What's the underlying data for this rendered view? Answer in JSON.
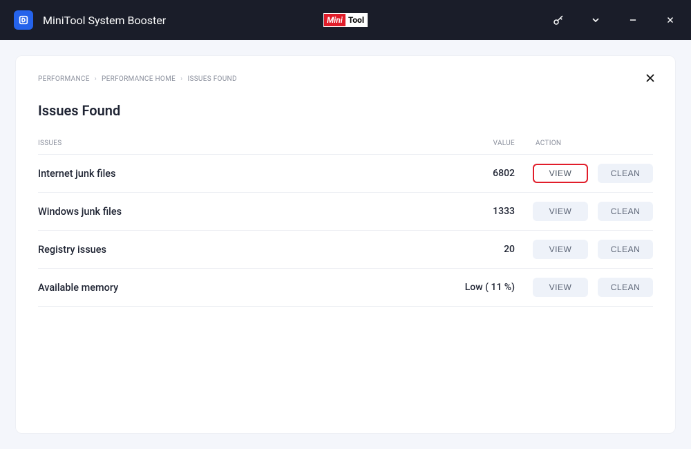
{
  "titlebar": {
    "app_name": "MiniTool System Booster",
    "brand_left": "Mini",
    "brand_right": "Tool"
  },
  "breadcrumb": {
    "items": [
      "PERFORMANCE",
      "PERFORMANCE HOME",
      "ISSUES FOUND"
    ]
  },
  "page_title": "Issues Found",
  "columns": {
    "issues": "ISSUES",
    "value": "VALUE",
    "action": "ACTION"
  },
  "buttons": {
    "view": "VIEW",
    "clean": "CLEAN"
  },
  "rows": [
    {
      "issue": "Internet junk files",
      "value": "6802",
      "highlight_view": true
    },
    {
      "issue": "Windows junk files",
      "value": "1333",
      "highlight_view": false
    },
    {
      "issue": "Registry issues",
      "value": "20",
      "highlight_view": false
    },
    {
      "issue": "Available memory",
      "value": "Low ( 11 %)",
      "highlight_view": false
    }
  ]
}
